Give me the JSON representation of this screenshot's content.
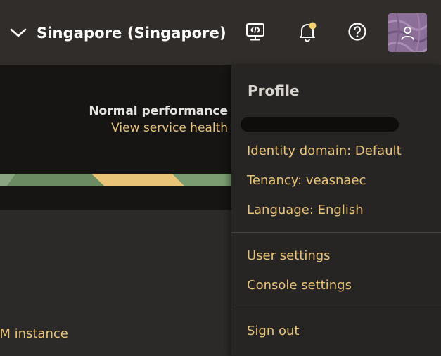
{
  "header": {
    "region": "Singapore (Singapore)",
    "icons": {
      "region_toggle": "chevron-down-icon",
      "cloud_shell": "cloud-shell-icon",
      "notifications": "bell-icon",
      "help": "help-icon",
      "profile": "user-icon"
    },
    "notification_dot_color": "#f3d06a"
  },
  "background_page": {
    "status": "Normal performance",
    "service_health_link": "View service health",
    "vm_link": "VM instance"
  },
  "profile_menu": {
    "title": "Profile",
    "identity_domain": "Identity domain: Default",
    "tenancy": "Tenancy: veasnaec",
    "language": "Language: English",
    "user_settings": "User settings",
    "console_settings": "Console settings",
    "sign_out": "Sign out"
  },
  "colors": {
    "link": "#e8c47a",
    "header_bg": "#312d2a",
    "menu_bg": "#272523",
    "avatar_bg": "#8c6f99"
  }
}
